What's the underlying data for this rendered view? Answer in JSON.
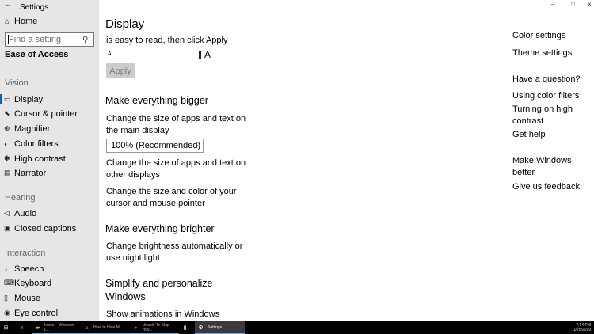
{
  "window": {
    "app_title": "Settings",
    "controls": {
      "minimize": "–",
      "maximize": "□",
      "close": "×"
    }
  },
  "sidebar": {
    "home_label": "Home",
    "search_placeholder": "Find a setting",
    "section_title": "Ease of Access",
    "groups": [
      {
        "label": "Vision",
        "items": [
          "Display",
          "Cursor & pointer",
          "Magnifier",
          "Color filters",
          "High contrast",
          "Narrator"
        ]
      },
      {
        "label": "Hearing",
        "items": [
          "Audio",
          "Closed captions"
        ]
      },
      {
        "label": "Interaction",
        "items": [
          "Speech",
          "Keyboard",
          "Mouse",
          "Eye control"
        ]
      }
    ],
    "active_item": "Display"
  },
  "main": {
    "title": "Display",
    "text_size_instruction": "is easy to read, then click Apply",
    "slider_small_label": "A",
    "slider_large_label": "A",
    "apply_label": "Apply",
    "bigger_heading": "Make everything bigger",
    "bigger_desc": "Change the size of apps and text on the main display",
    "scale_value": "100% (Recommended)",
    "other_displays_link": "Change the size of apps and text on other displays",
    "cursor_link": "Change the size and color of your cursor and mouse pointer",
    "brighter_heading": "Make everything brighter",
    "brightness_link": "Change brightness automatically or use night light",
    "simplify_heading": "Simplify and personalize Windows",
    "animations_label": "Show animations in Windows"
  },
  "related": {
    "color_settings": "Color settings",
    "theme_settings": "Theme settings",
    "question_heading": "Have a question?",
    "using_color_filters": "Using color filters",
    "turning_high_contrast": "Turning on high contrast",
    "get_help": "Get help",
    "better_heading": "Make Windows better",
    "feedback": "Give us feedback"
  },
  "taskbar": {
    "items": [
      {
        "icon": "explorer-icon",
        "label": "Inbox – Windows L..."
      },
      {
        "icon": "app-icon",
        "label": "How to Hide Mi..."
      },
      {
        "icon": "chrome-icon",
        "label": "Unable To Stop Hav..."
      },
      {
        "icon": "app-icon",
        "label": ""
      },
      {
        "icon": "gear-icon",
        "label": "Settings"
      }
    ],
    "tray_time": "7:14 PM",
    "tray_date": "1/25/2019"
  },
  "colors": {
    "accent": "#0063b1",
    "sidebar_bg": "#e6e6e6",
    "taskbar_bg": "#000000"
  }
}
